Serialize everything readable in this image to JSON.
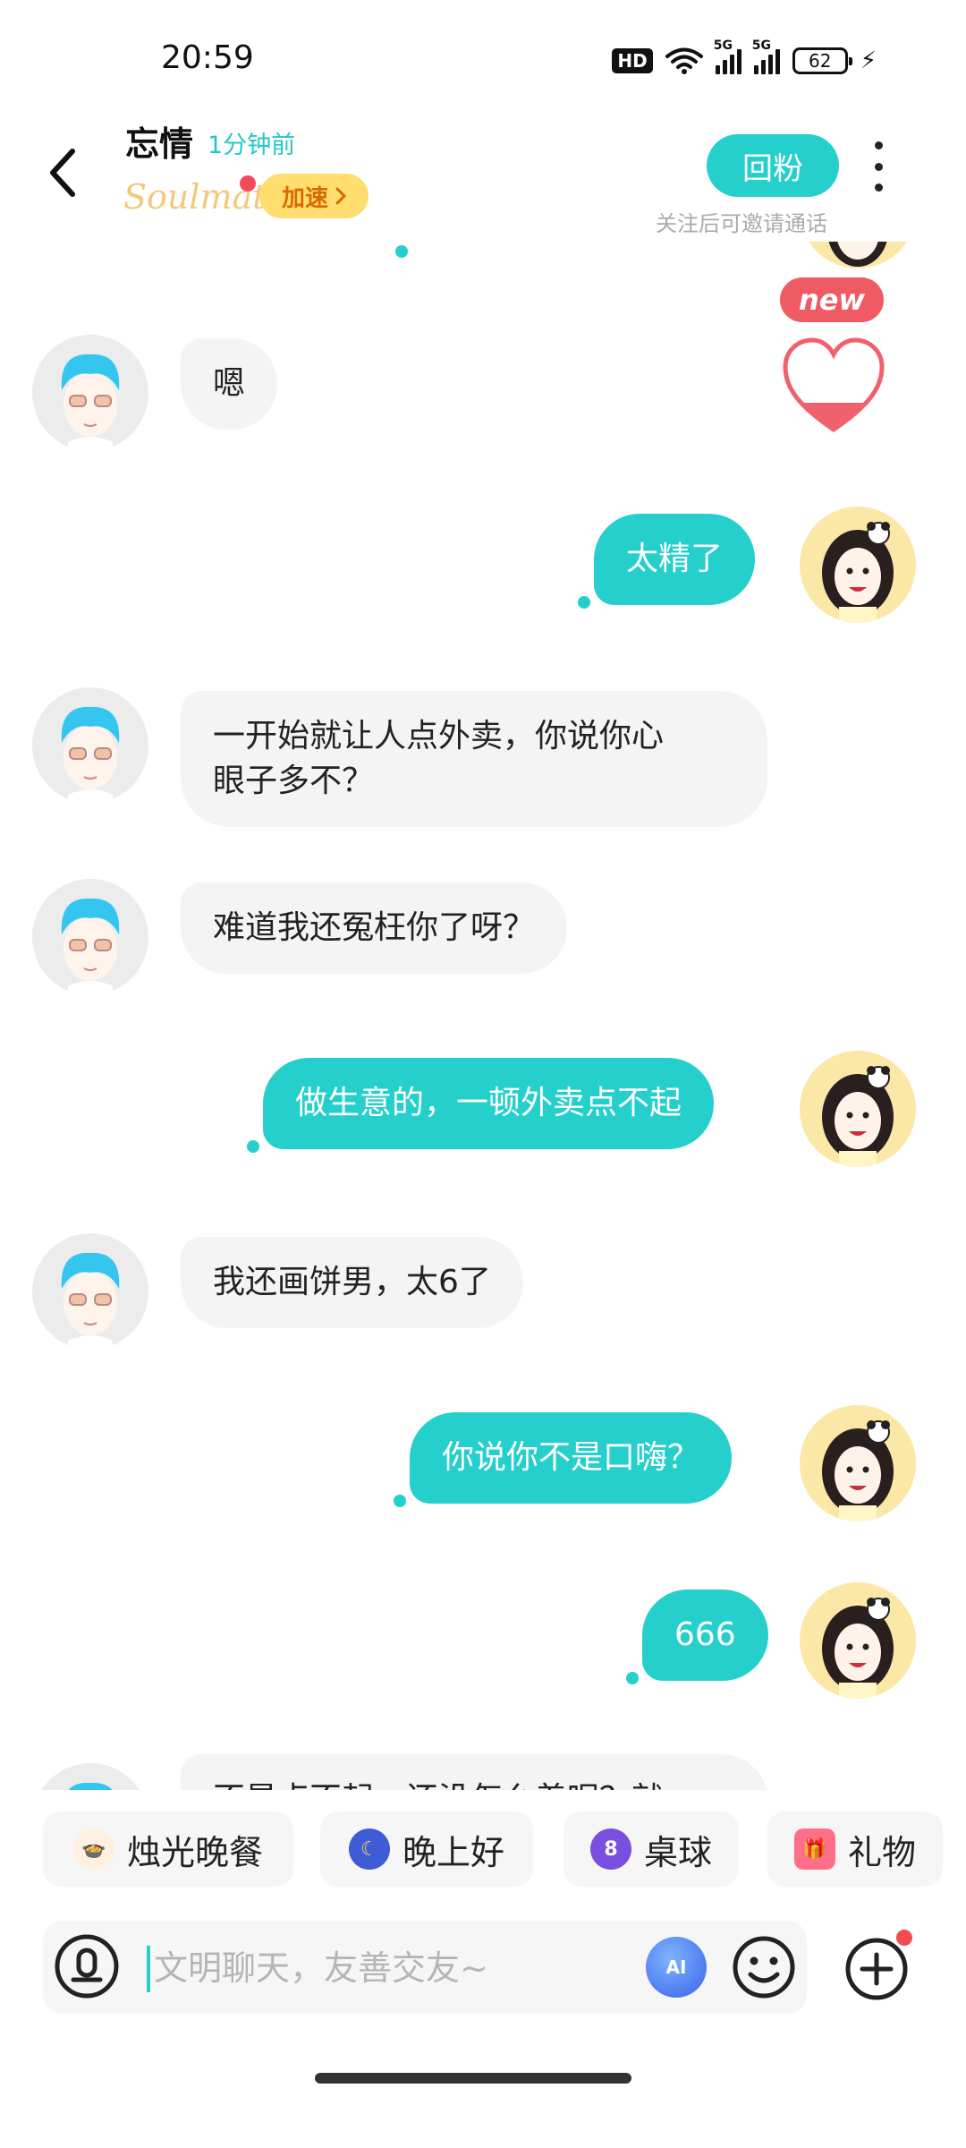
{
  "status_bar": {
    "time": "20:59",
    "hd_label": "HD",
    "net1": "5G",
    "net2": "5G",
    "battery": "62"
  },
  "header": {
    "name": "忘情",
    "last_seen": "1分钟前",
    "soulmate_label": "Soulmate",
    "speed_label": "加速",
    "follow_label": "回粉",
    "follow_hint": "关注后可邀请通话"
  },
  "new_badge": "new",
  "messages": [
    {
      "side": "left",
      "text": "嗯"
    },
    {
      "side": "right",
      "text": "太精了"
    },
    {
      "side": "left",
      "text_line1": "一开始就让人点外卖，你说你心",
      "text_line2": "眼子多不？"
    },
    {
      "side": "left",
      "text": "难道我还冤枉你了呀？"
    },
    {
      "side": "right",
      "text": "做生意的，一顿外卖点不起"
    },
    {
      "side": "left",
      "text": "我还画饼男，太6了"
    },
    {
      "side": "right",
      "text": "你说你不是口嗨？"
    },
    {
      "side": "right",
      "text": "666"
    },
    {
      "side": "left",
      "text": "不是点不起，还没怎么着呢？就"
    }
  ],
  "quick_chips": [
    {
      "label": "烛光晚餐",
      "icon": "candle-dinner-icon"
    },
    {
      "label": "晚上好",
      "icon": "moon-icon"
    },
    {
      "label": "桌球",
      "icon": "billiard-ball-icon"
    },
    {
      "label": "礼物",
      "icon": "gift-icon"
    }
  ],
  "input": {
    "placeholder": "文明聊天，友善交友~",
    "ai_label": "AI"
  },
  "colors": {
    "accent": "#25cfcb",
    "bubble_left": "#f4f4f4",
    "speed_bg": "#ffde6f",
    "badge_red": "#f05a63"
  }
}
